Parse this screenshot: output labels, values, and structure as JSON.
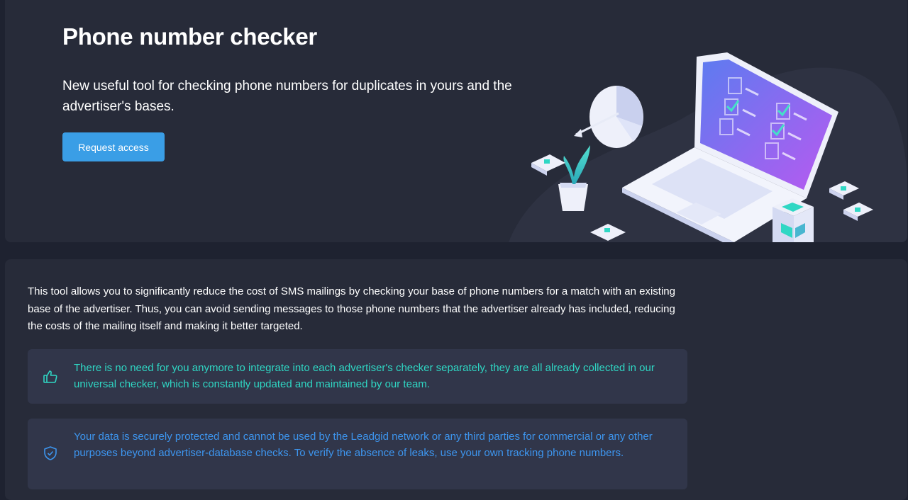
{
  "hero": {
    "title": "Phone number checker",
    "subtitle": "New useful tool for checking phone numbers for duplicates in yours and the advertiser's bases.",
    "button_label": "Request access",
    "illustration_icon": "laptop-checklist-illustration"
  },
  "content": {
    "description": "This tool allows you to significantly reduce the cost of SMS mailings by checking your base of phone numbers for a match with an existing base of the advertiser. Thus, you can avoid sending messages to those phone numbers that the advertiser already has included, reducing the costs of the mailing itself and making it better targeted.",
    "notes": [
      {
        "icon": "thumbs-up-icon",
        "text": "There is no need for you anymore to integrate into each advertiser's checker separately, they are all already collected in our universal checker, which is constantly updated and maintained by our team.",
        "color": "#2fd7c4"
      },
      {
        "icon": "shield-check-icon",
        "text": "Your data is securely protected and cannot be used by the Leadgid network or any third parties for commercial or any other purposes beyond advertiser-database checks. To verify the absence of leaks, use your own tracking phone numbers.",
        "color": "#3d95ee"
      }
    ]
  },
  "colors": {
    "page_bg": "#1e2230",
    "panel_bg": "#272b39",
    "note_bg": "#31364a",
    "button_bg": "#3a9ee6",
    "teal_accent": "#2fd7c4",
    "blue_accent": "#3d95ee"
  }
}
